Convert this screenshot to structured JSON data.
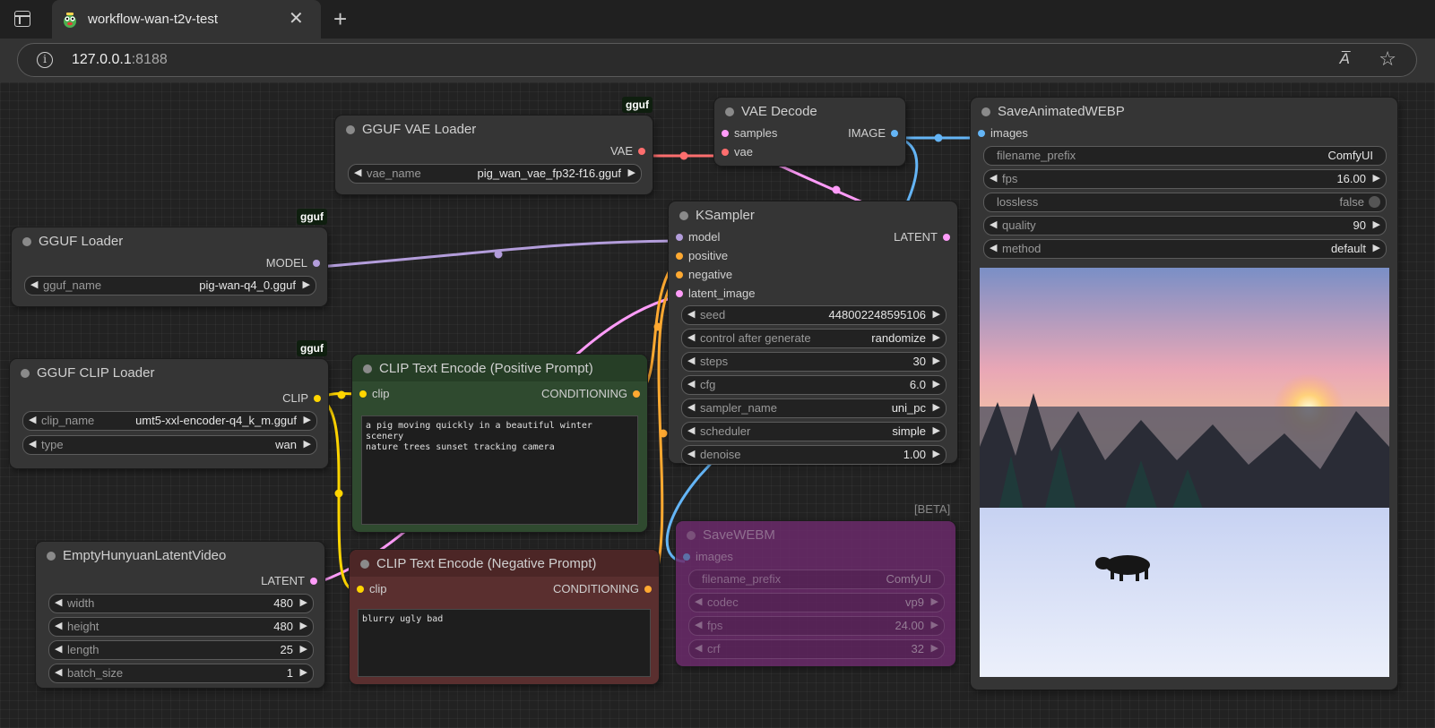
{
  "browser": {
    "tab_title": "workflow-wan-t2v-test",
    "url_host": "127.0.0.1",
    "url_port": ":8188",
    "close_glyph": "✕",
    "new_tab_glyph": "+",
    "info_glyph": "i",
    "read_aloud_glyph": "A̅",
    "star_glyph": "☆"
  },
  "badges": {
    "gguf": "gguf",
    "beta": "[BETA]"
  },
  "colors": {
    "model": "#b39ddb",
    "vae": "#ff6e6e",
    "image": "#64b5f6",
    "latent": "#ff9cf9",
    "clip": "#ffd500",
    "conditioning": "#ffa931",
    "positive_node": "#2f4a2f",
    "negative_node": "#5a2f2f",
    "savewebm_node": "#6a2a6a"
  },
  "arrows": {
    "left": "◀",
    "right": "▶"
  },
  "nodes": {
    "vae_loader": {
      "title": "GGUF VAE Loader",
      "output": "VAE",
      "widgets": [
        {
          "name": "vae_name",
          "value": "pig_wan_vae_fp32-f16.gguf"
        }
      ]
    },
    "gguf_loader": {
      "title": "GGUF Loader",
      "output": "MODEL",
      "widgets": [
        {
          "name": "gguf_name",
          "value": "pig-wan-q4_0.gguf"
        }
      ]
    },
    "clip_loader": {
      "title": "GGUF CLIP Loader",
      "output": "CLIP",
      "widgets": [
        {
          "name": "clip_name",
          "value": "umt5-xxl-encoder-q4_k_m.gguf"
        },
        {
          "name": "type",
          "value": "wan"
        }
      ]
    },
    "vae_decode": {
      "title": "VAE Decode",
      "inputs": [
        "samples",
        "vae"
      ],
      "output": "IMAGE"
    },
    "ksampler": {
      "title": "KSampler",
      "inputs": [
        "model",
        "positive",
        "negative",
        "latent_image"
      ],
      "output": "LATENT",
      "widgets": [
        {
          "name": "seed",
          "value": "448002248595106"
        },
        {
          "name": "control after generate",
          "value": "randomize"
        },
        {
          "name": "steps",
          "value": "30"
        },
        {
          "name": "cfg",
          "value": "6.0"
        },
        {
          "name": "sampler_name",
          "value": "uni_pc"
        },
        {
          "name": "scheduler",
          "value": "simple"
        },
        {
          "name": "denoise",
          "value": "1.00"
        }
      ]
    },
    "positive": {
      "title": "CLIP Text Encode (Positive Prompt)",
      "input": "clip",
      "output": "CONDITIONING",
      "text": "a pig moving quickly in a beautiful winter scenery\nnature trees sunset tracking camera"
    },
    "negative": {
      "title": "CLIP Text Encode (Negative Prompt)",
      "input": "clip",
      "output": "CONDITIONING",
      "text": "blurry ugly bad"
    },
    "latent_video": {
      "title": "EmptyHunyuanLatentVideo",
      "output": "LATENT",
      "widgets": [
        {
          "name": "width",
          "value": "480"
        },
        {
          "name": "height",
          "value": "480"
        },
        {
          "name": "length",
          "value": "25"
        },
        {
          "name": "batch_size",
          "value": "1"
        }
      ]
    },
    "save_webm": {
      "title": "SaveWEBM",
      "input": "images",
      "widgets": [
        {
          "name": "filename_prefix",
          "value": "ComfyUI"
        },
        {
          "name": "codec",
          "value": "vp9"
        },
        {
          "name": "fps",
          "value": "24.00"
        },
        {
          "name": "crf",
          "value": "32"
        }
      ]
    },
    "save_webp": {
      "title": "SaveAnimatedWEBP",
      "input": "images",
      "widgets": [
        {
          "name": "filename_prefix",
          "value": "ComfyUI"
        },
        {
          "name": "fps",
          "value": "16.00"
        },
        {
          "name": "lossless",
          "value": "false"
        },
        {
          "name": "quality",
          "value": "90"
        },
        {
          "name": "method",
          "value": "default"
        }
      ]
    }
  }
}
